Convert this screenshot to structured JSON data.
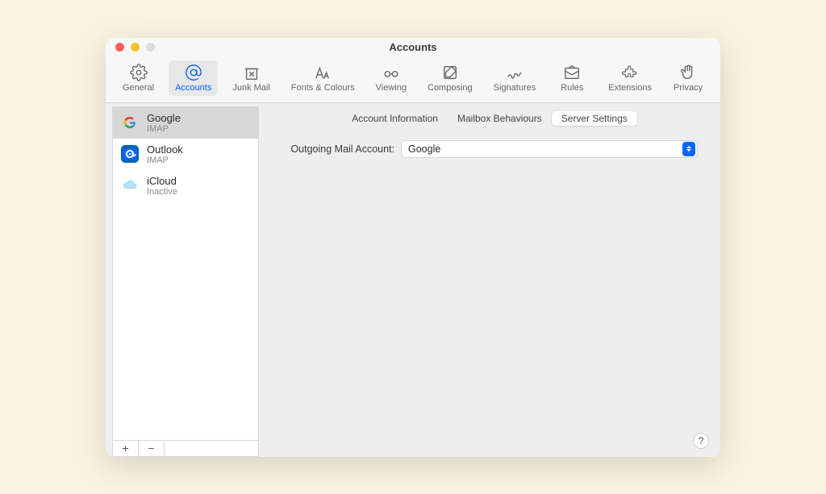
{
  "window": {
    "title": "Accounts"
  },
  "toolbar": {
    "items": [
      {
        "label": "General"
      },
      {
        "label": "Accounts"
      },
      {
        "label": "Junk Mail"
      },
      {
        "label": "Fonts & Colours"
      },
      {
        "label": "Viewing"
      },
      {
        "label": "Composing"
      },
      {
        "label": "Signatures"
      },
      {
        "label": "Rules"
      },
      {
        "label": "Extensions"
      },
      {
        "label": "Privacy"
      }
    ],
    "selected": "Accounts"
  },
  "sidebar": {
    "accounts": [
      {
        "name": "Google",
        "sub": "IMAP",
        "icon": "google"
      },
      {
        "name": "Outlook",
        "sub": "IMAP",
        "icon": "outlook"
      },
      {
        "name": "iCloud",
        "sub": "Inactive",
        "icon": "icloud"
      }
    ],
    "selected": "Google",
    "add": "+",
    "remove": "−"
  },
  "tabs": {
    "items": [
      "Account Information",
      "Mailbox Behaviours",
      "Server Settings"
    ],
    "selected": "Server Settings"
  },
  "form": {
    "outgoing_label": "Outgoing Mail Account:",
    "outgoing_value": "Google"
  },
  "help": "?"
}
